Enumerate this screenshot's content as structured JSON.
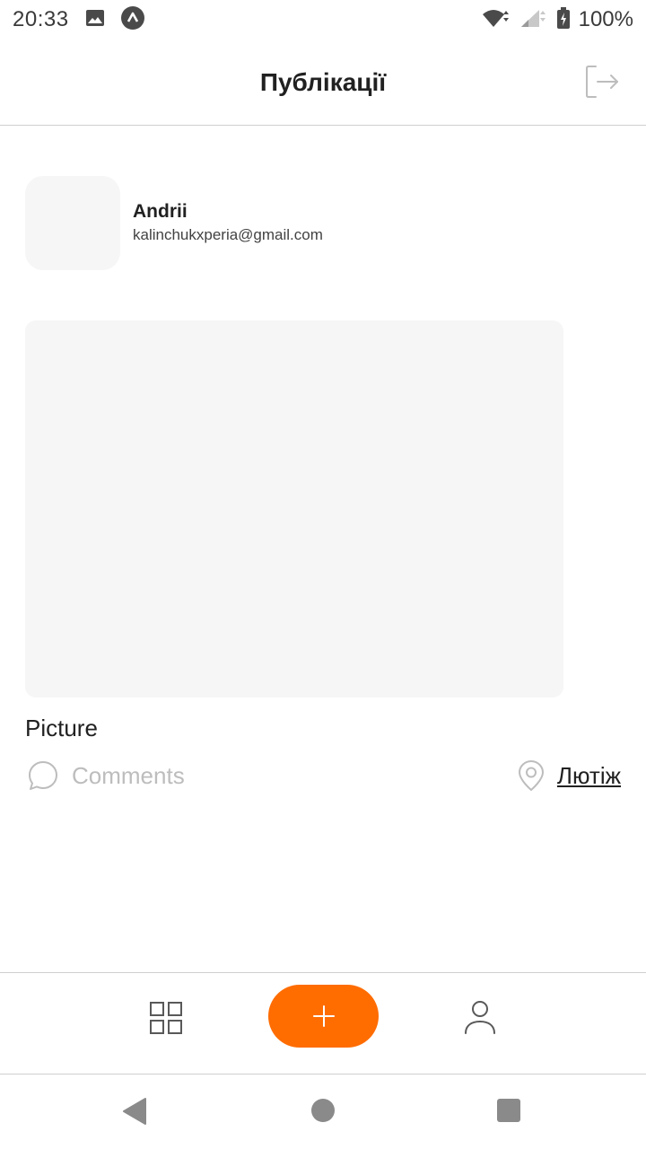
{
  "status_bar": {
    "time": "20:33",
    "battery": "100%",
    "icons": [
      "image-icon",
      "app-notification-icon",
      "wifi-icon",
      "signal-icon",
      "battery-icon"
    ]
  },
  "header": {
    "title": "Публікації",
    "logout_icon": "logout-icon"
  },
  "user": {
    "name": "Andrii",
    "email": "kalinchukxperia@gmail.com"
  },
  "post": {
    "title": "Picture",
    "comments_label": "Comments",
    "location_label": "Лютіж"
  },
  "tab_bar": {
    "items": [
      {
        "name": "posts-grid",
        "icon": "grid-icon"
      },
      {
        "name": "create-post",
        "icon": "plus-icon"
      },
      {
        "name": "profile",
        "icon": "user-icon"
      }
    ]
  },
  "colors": {
    "accent": "#FF6C00",
    "placeholder": "#F6F6F6",
    "muted_text": "#BDBDBD",
    "divider": "#CFCFCF"
  }
}
